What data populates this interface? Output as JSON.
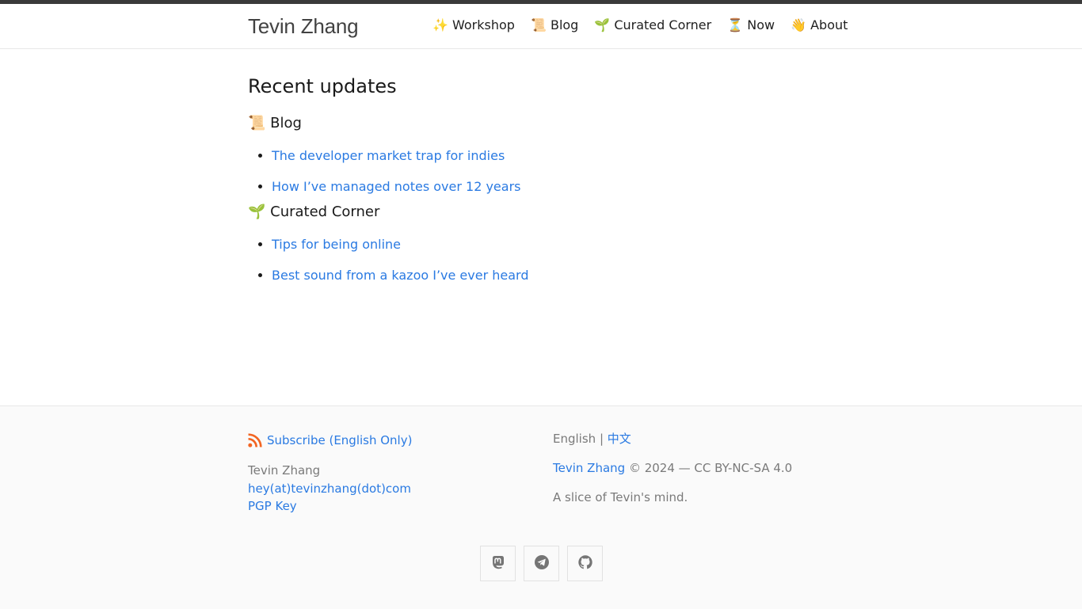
{
  "site": {
    "title": "Tevin Zhang"
  },
  "nav": [
    {
      "label": "✨ Workshop"
    },
    {
      "label": "📜 Blog"
    },
    {
      "label": "🌱 Curated Corner"
    },
    {
      "label": "⏳ Now"
    },
    {
      "label": "👋 About"
    }
  ],
  "main": {
    "heading": "Recent updates",
    "groups": [
      {
        "title": "📜 Blog",
        "posts": [
          "The developer market trap for indies",
          "How I’ve managed notes over 12 years"
        ]
      },
      {
        "title": "🌱 Curated Corner",
        "posts": [
          "Tips for being online",
          "Best sound from a kazoo I’ve ever heard"
        ]
      }
    ]
  },
  "footer": {
    "subscribe_label": "Subscribe (English Only)",
    "contact_name": "Tevin Zhang",
    "email": "hey(at)tevinzhang(dot)com",
    "pgp_label": "PGP Key",
    "lang_current": "English",
    "lang_separator": "|",
    "lang_alt": "中文",
    "copyright_name": "Tevin Zhang",
    "copyright_text": "© 2024 — CC BY-NC-SA 4.0",
    "tagline": "A slice of Tevin's mind.",
    "social_icons": [
      "mastodon-icon",
      "telegram-icon",
      "github-icon"
    ]
  },
  "colors": {
    "link": "#2a7ae2",
    "rss": "#f26522",
    "topbar": "#3a3a3a",
    "muted_text": "#7a7a7a"
  }
}
